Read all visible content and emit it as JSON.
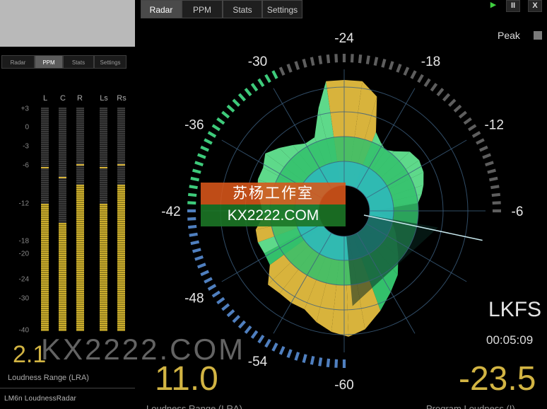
{
  "left_panel": {
    "tabs": [
      "Radar",
      "PPM",
      "Stats",
      "Settings"
    ],
    "active_tab": "PPM",
    "scale": [
      "+3",
      "0",
      "-3",
      "-6",
      "-12",
      "-18",
      "-20",
      "-24",
      "-30",
      "-40"
    ],
    "channels": [
      "L",
      "C",
      "R",
      "Ls",
      "Rs"
    ],
    "meter_levels_db": [
      -12,
      -15,
      -9,
      -12,
      -9
    ],
    "meter_peaks_db": [
      -6.2,
      -7.8,
      -5.8,
      -6.2,
      -5.8
    ],
    "lra_value": "2.1",
    "lra_label": "Loudness Range (LRA)",
    "brand": "LM6n LoudnessRadar"
  },
  "main_tabs": [
    "Radar",
    "PPM",
    "Stats",
    "Settings"
  ],
  "active_main_tab": "Radar",
  "controls": {
    "play": "▶",
    "pause": "II",
    "close": "X"
  },
  "peak_label": "Peak",
  "radar": {
    "ring_labels": [
      "-24",
      "-18",
      "-12",
      "-6",
      "-60",
      "-54",
      "-48",
      "-42",
      "-36",
      "-30"
    ],
    "ring_colors": {
      "blue": "#4f7fbf",
      "green": "#3ecb7b",
      "gray": "#5e5e5e"
    },
    "fill_colors": {
      "gold": "#d8b33c",
      "light_green": "#5ed98a",
      "green": "#33c06b",
      "teal": "#2fb9b9"
    }
  },
  "unit": "LKFS",
  "time": "00:05:09",
  "lra_value": "11.0",
  "lra_label": "Loudness Range (LRA)",
  "program_loudness_value": "-23.5",
  "program_loudness_label": "Program Loudness (I)",
  "watermark": {
    "top": "苏杨工作室",
    "bottom": "KX2222.COM",
    "overlay": "KX2222.COM"
  }
}
